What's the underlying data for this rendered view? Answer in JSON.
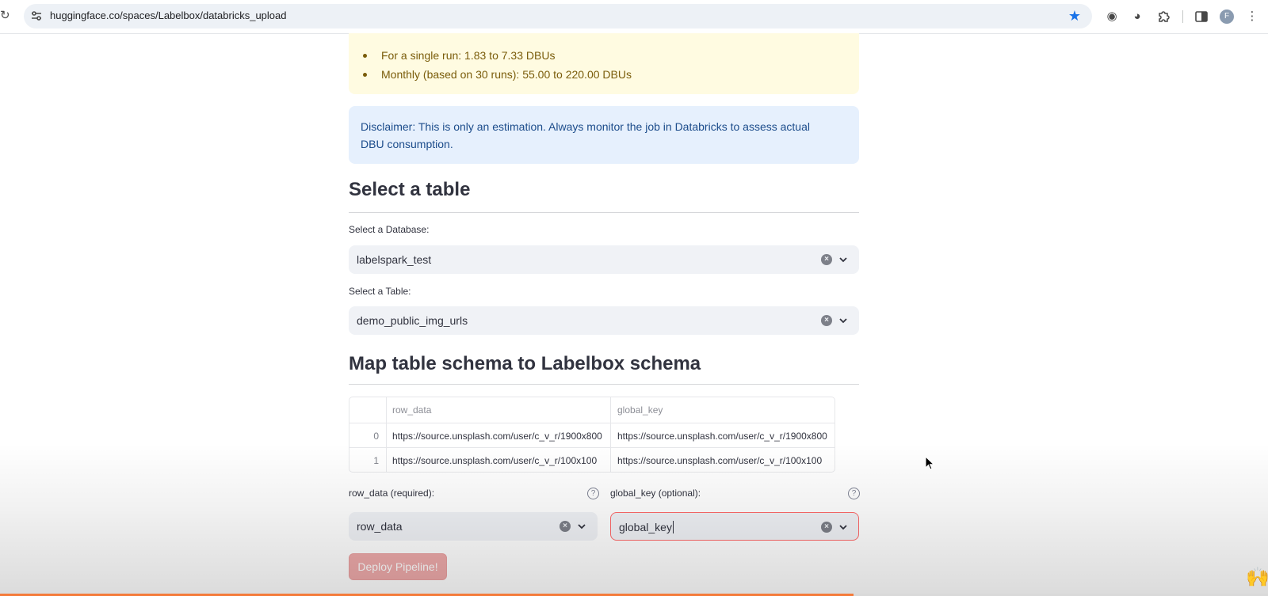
{
  "browser": {
    "url": "huggingface.co/spaces/Labelbox/databricks_upload",
    "avatar_initial": "F"
  },
  "cost_callout": {
    "items": [
      "For a single run: 1.83 to 7.33 DBUs",
      "Monthly (based on 30 runs): 55.00 to 220.00 DBUs"
    ]
  },
  "disclaimer": {
    "text": "Disclaimer: This is only an estimation. Always monitor the job in Databricks to assess actual DBU consumption."
  },
  "select_table": {
    "heading": "Select a table",
    "database_label": "Select a Database:",
    "database_value": "labelspark_test",
    "table_label": "Select a Table:",
    "table_value": "demo_public_img_urls"
  },
  "mapping": {
    "heading": "Map table schema to Labelbox schema",
    "columns": [
      "row_data",
      "global_key"
    ],
    "rows": [
      {
        "index": "0",
        "row_data": "https://source.unsplash.com/user/c_v_r/1900x800",
        "global_key": "https://source.unsplash.com/user/c_v_r/1900x800"
      },
      {
        "index": "1",
        "row_data": "https://source.unsplash.com/user/c_v_r/100x100",
        "global_key": "https://source.unsplash.com/user/c_v_r/100x100"
      }
    ],
    "row_data_label": "row_data (required):",
    "row_data_value": "row_data",
    "global_key_label": "global_key (optional):",
    "global_key_value": "global_key",
    "deploy_label": "Deploy Pipeline!"
  },
  "video": {
    "progress_fraction": 0.673,
    "emoji": "🙌"
  },
  "colors": {
    "accent": "#ff4b4b",
    "warning_bg": "#fffbe1",
    "info_bg": "#e6f0fd",
    "progress": "#f47b3a"
  }
}
